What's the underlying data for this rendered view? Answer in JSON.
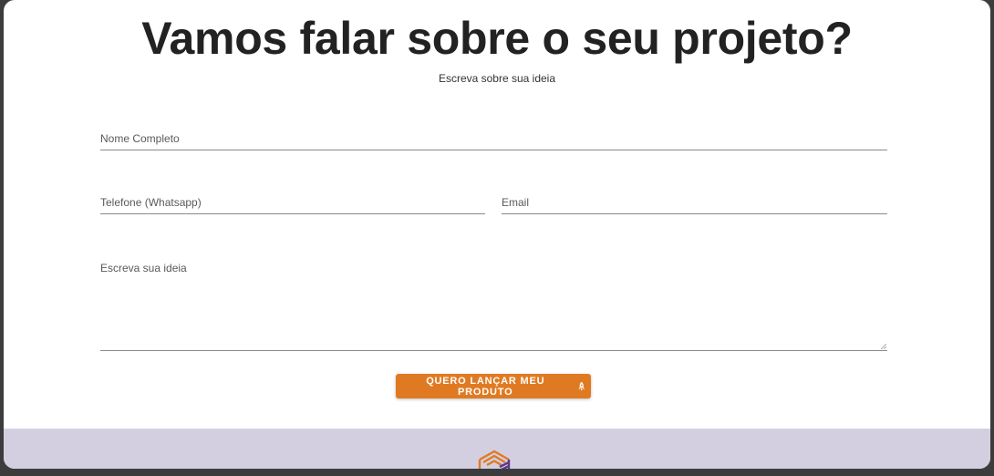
{
  "header": {
    "title": "Vamos falar sobre o seu projeto?",
    "subtitle": "Escreva sobre sua ideia"
  },
  "form": {
    "name_label": "Nome Completo",
    "phone_label": "Telefone (Whatsapp)",
    "email_label": "Email",
    "idea_label": "Escreva sua ideia",
    "submit_label": "QUERO LANÇAR MEU PRODUTO",
    "submit_icon": "rocket-icon"
  },
  "colors": {
    "accent": "#e07a22",
    "footer_bg": "#d4cfe0",
    "title": "#222222",
    "logo_orange": "#e07a22",
    "logo_purple": "#5b3a8c"
  }
}
